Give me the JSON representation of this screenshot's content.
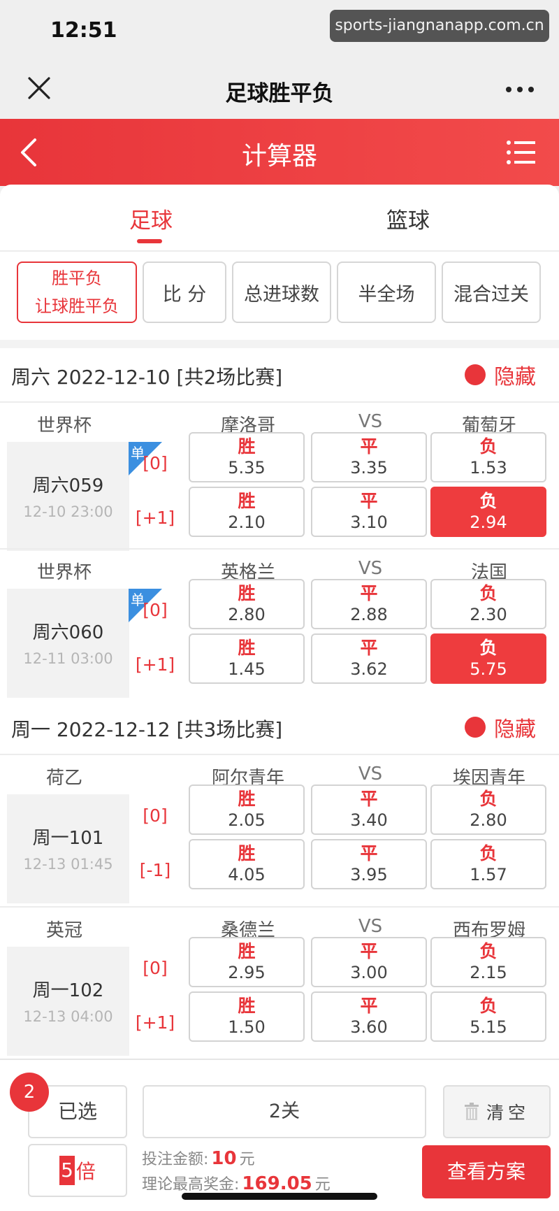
{
  "status": {
    "time": "12:51",
    "watermark": "sports-jiangnanapp.com.cn"
  },
  "wechat_bar": {
    "title": "足球胜平负"
  },
  "header": {
    "title": "计算器"
  },
  "sport_tabs": [
    {
      "label": "足球",
      "active": true
    },
    {
      "label": "篮球",
      "active": false
    }
  ],
  "play_types": [
    {
      "label": "胜平负",
      "label2": "让球胜平负",
      "active": true
    },
    {
      "label": "比 分"
    },
    {
      "label": "总进球数"
    },
    {
      "label": "半全场"
    },
    {
      "label": "混合过关"
    }
  ],
  "days": [
    {
      "title": "周六 2022-12-10 [共2场比赛]",
      "hide_label": "隐藏",
      "matches": [
        {
          "league": "世界杯",
          "home": "摩洛哥",
          "vs": "VS",
          "away": "葡萄牙",
          "code": "周六059",
          "time": "12-10 23:00",
          "single_tag": "单",
          "rows": [
            {
              "handicap": "[0]",
              "odds": [
                {
                  "label": "胜",
                  "value": "5.35"
                },
                {
                  "label": "平",
                  "value": "3.35"
                },
                {
                  "label": "负",
                  "value": "1.53"
                }
              ]
            },
            {
              "handicap": "[+1]",
              "odds": [
                {
                  "label": "胜",
                  "value": "2.10"
                },
                {
                  "label": "平",
                  "value": "3.10"
                },
                {
                  "label": "负",
                  "value": "2.94",
                  "selected": true
                }
              ]
            }
          ]
        },
        {
          "league": "世界杯",
          "home": "英格兰",
          "vs": "VS",
          "away": "法国",
          "code": "周六060",
          "time": "12-11 03:00",
          "single_tag": "单",
          "rows": [
            {
              "handicap": "[0]",
              "odds": [
                {
                  "label": "胜",
                  "value": "2.80"
                },
                {
                  "label": "平",
                  "value": "2.88"
                },
                {
                  "label": "负",
                  "value": "2.30"
                }
              ]
            },
            {
              "handicap": "[+1]",
              "odds": [
                {
                  "label": "胜",
                  "value": "1.45"
                },
                {
                  "label": "平",
                  "value": "3.62"
                },
                {
                  "label": "负",
                  "value": "5.75",
                  "selected": true
                }
              ]
            }
          ]
        }
      ]
    },
    {
      "title": "周一 2022-12-12 [共3场比赛]",
      "hide_label": "隐藏",
      "matches": [
        {
          "league": "荷乙",
          "home": "阿尔青年",
          "vs": "VS",
          "away": "埃因青年",
          "code": "周一101",
          "time": "12-13 01:45",
          "rows": [
            {
              "handicap": "[0]",
              "odds": [
                {
                  "label": "胜",
                  "value": "2.05"
                },
                {
                  "label": "平",
                  "value": "3.40"
                },
                {
                  "label": "负",
                  "value": "2.80"
                }
              ]
            },
            {
              "handicap": "[-1]",
              "odds": [
                {
                  "label": "胜",
                  "value": "4.05"
                },
                {
                  "label": "平",
                  "value": "3.95"
                },
                {
                  "label": "负",
                  "value": "1.57"
                }
              ]
            }
          ]
        },
        {
          "league": "英冠",
          "home": "桑德兰",
          "vs": "VS",
          "away": "西布罗姆",
          "code": "周一102",
          "time": "12-13 04:00",
          "rows": [
            {
              "handicap": "[0]",
              "odds": [
                {
                  "label": "胜",
                  "value": "2.95"
                },
                {
                  "label": "平",
                  "value": "3.00"
                },
                {
                  "label": "负",
                  "value": "2.15"
                }
              ]
            },
            {
              "handicap": "[+1]",
              "odds": [
                {
                  "label": "胜",
                  "value": "1.50"
                },
                {
                  "label": "平",
                  "value": "3.60"
                },
                {
                  "label": "负",
                  "value": "5.15"
                }
              ]
            }
          ]
        }
      ]
    }
  ],
  "bottom": {
    "selected_count": "2",
    "selected_label": "已选",
    "pass_label": "2关",
    "clear_label": "清空",
    "multiplier": "5",
    "multiplier_unit": "倍",
    "bet_amount_label": "投注金额:",
    "bet_amount": "10",
    "bet_amount_unit": "元",
    "max_prize_label": "理论最高奖金:",
    "max_prize": "169.05",
    "max_prize_unit": "元",
    "view_plan_label": "查看方案"
  },
  "colors": {
    "accent": "#e8353a",
    "selected_cell": "#ee3c3e",
    "single_tag": "#3b8fe0"
  }
}
